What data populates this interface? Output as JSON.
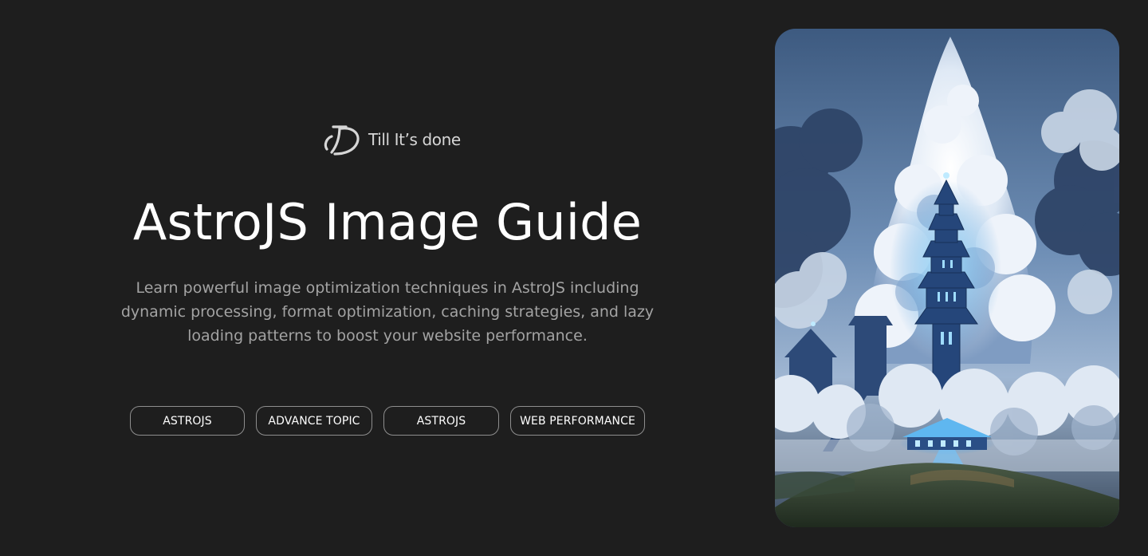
{
  "brand": {
    "logo_icon": "td-monogram-logo",
    "name": "Till It’s done"
  },
  "hero": {
    "title": "AstroJS Image Guide",
    "description": "Learn powerful image optimization techniques in AstroJS including dynamic processing, format optimization, caching strategies, and lazy loading patterns to boost your website performance."
  },
  "tags": [
    {
      "label": "ASTROJS"
    },
    {
      "label": "ADVANCE TOPIC"
    },
    {
      "label": "ASTROJS"
    },
    {
      "label": "WEB PERFORMANCE"
    }
  ],
  "cover_image": {
    "subject": "fantasy-pagoda-tower-in-clouds",
    "colors": {
      "sky_top": "#3d5a80",
      "sky_mid": "#6f8fb6",
      "cloud": "#e4ecf5",
      "cloud_shadow": "#5f7fa8",
      "tower": "#274a7a",
      "glow": "#6fc7ff",
      "ground": "#2a3424"
    }
  },
  "theme": {
    "background": "#1e1e1e",
    "text_primary": "#ffffff",
    "text_secondary": "#a3a3a3",
    "tag_border": "#8e8e8e"
  }
}
